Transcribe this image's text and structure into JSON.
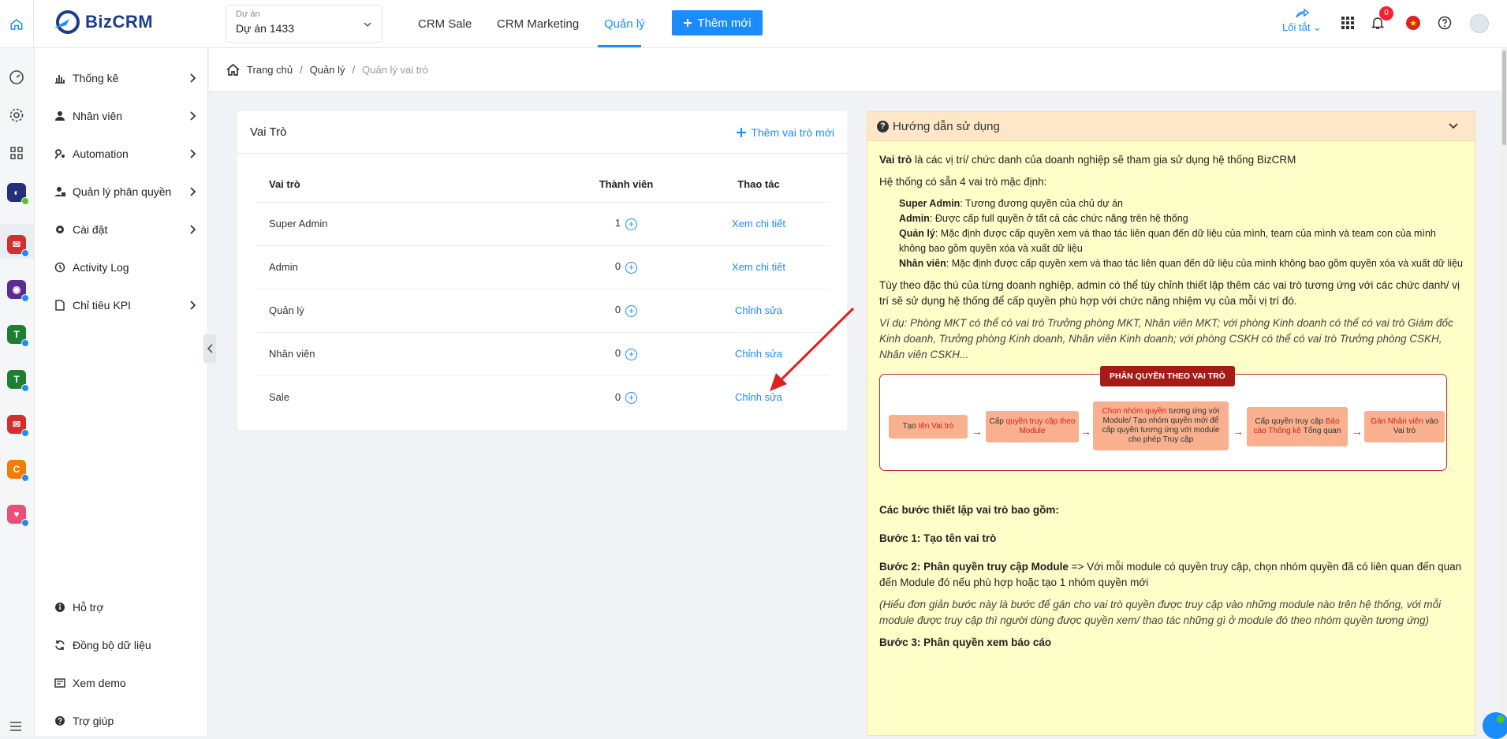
{
  "top": {
    "logo_text": "BizCRM",
    "project_label": "Dự án",
    "project_value": "Dự án 1433",
    "nav": [
      "CRM Sale",
      "CRM Marketing",
      "Quản lý"
    ],
    "new_button": "Thêm mới",
    "shortcut_label": "Lối tắt",
    "notification_count": "0"
  },
  "sidebar": {
    "items": [
      {
        "label": "Thống kê",
        "icon": "bar-chart-icon"
      },
      {
        "label": "Nhân viên",
        "icon": "user-icon"
      },
      {
        "label": "Automation",
        "icon": "automation-icon"
      },
      {
        "label": "Quản lý phân quyền",
        "icon": "user-lock-icon"
      },
      {
        "label": "Cài đặt",
        "icon": "gear-icon"
      },
      {
        "label": "Activity Log",
        "icon": "history-icon"
      },
      {
        "label": "Chỉ tiêu KPI",
        "icon": "file-icon"
      }
    ],
    "bottom": [
      {
        "label": "Hỗ trợ",
        "icon": "info-icon"
      },
      {
        "label": "Đồng bộ dữ liệu",
        "icon": "sync-icon"
      },
      {
        "label": "Xem demo",
        "icon": "demo-icon"
      },
      {
        "label": "Trợ giúp",
        "icon": "help-icon"
      }
    ]
  },
  "breadcrumb": {
    "home": "Trang chủ",
    "level1": "Quản lý",
    "current": "Quản lý vai trò"
  },
  "roles": {
    "title": "Vai Trò",
    "add_label": "Thêm vai trò mới",
    "headers": [
      "Vai trò",
      "Thành viên",
      "Thao tác"
    ],
    "rows": [
      {
        "name": "Super Admin",
        "members": "1",
        "action": "Xem chi tiết"
      },
      {
        "name": "Admin",
        "members": "0",
        "action": "Xem chi tiết"
      },
      {
        "name": "Quản lý",
        "members": "0",
        "action": "Chỉnh sửa"
      },
      {
        "name": "Nhân viên",
        "members": "0",
        "action": "Chỉnh sửa"
      },
      {
        "name": "Sale",
        "members": "0",
        "action": "Chỉnh sửa"
      }
    ]
  },
  "guide": {
    "title": "Hướng dẫn sử dụng",
    "intro_bold": "Vai trò",
    "intro_rest": " là các vị trí/ chức danh của doanh nghiệp sẽ tham gia sử dụng hệ thống BizCRM",
    "default_roles": "Hệ thống có sẵn 4 vai trò mặc định:",
    "list": [
      {
        "b": "Super Admin",
        "t": ": Tương đương quyền của chủ dự án"
      },
      {
        "b": "Admin",
        "t": ": Được cấp full quyền ở tất cả các chức năng trên hệ thống"
      },
      {
        "b": "Quản lý",
        "t": ": Mặc định được cấp quyền xem và thao tác liên quan đến dữ liệu của mình, team của mình và team con của mình không bao gồm quyền xóa và xuất dữ liệu"
      },
      {
        "b": "Nhân viên",
        "t": ": Mặc định được cấp quyền xem và thao tác liên quan đến dữ liệu của mình không bao gồm quyền xóa và xuất dữ liệu"
      }
    ],
    "custom": "Tùy theo đặc thù của từng doanh nghiệp, admin có thể tùy chỉnh thiết lập thêm các vai trò tương ứng với các chức danh/ vị trí sẽ sử dụng hệ thống để cấp quyền phù hợp với chức năng nhiệm vụ của mỗi vị trí đó.",
    "example": "Ví dụ: Phòng MKT có thể có vai trò Trưởng phòng MKT, Nhân viên MKT; với phòng Kinh doanh có thể có vai trò Giám đốc Kinh doanh, Trưởng phòng Kinh doanh, Nhân viên Kinh doanh; với phòng CSKH có thể có vai trò Trưởng phòng CSKH, Nhân viên CSKH...",
    "flow_title": "PHÂN QUYỀN THEO VAI TRÒ",
    "flow": [
      {
        "a": "Tạo ",
        "r": "tên Vai trò",
        "c": ""
      },
      {
        "a": "Cấp ",
        "r": "quyền truy cập theo Module",
        "c": ""
      },
      {
        "a": "",
        "r": "Chọn nhóm quyền",
        "c": " tương ứng với Module/ Tạo nhóm quyền mới để cấp quyền tương ứng với module cho phép Truy cập"
      },
      {
        "a": "Cấp quyền truy cập ",
        "r": "Báo cáo Thống kê",
        "c": " Tổng quan"
      },
      {
        "a": "",
        "r": "Gán Nhân viên",
        "c": " vào Vai trò"
      }
    ],
    "steps_title": "Các bước thiết lập vai trò bao gồm:",
    "step1": "Bước 1: Tạo tên vai trò",
    "step2_bold": "Bước 2: Phân quyền truy cập Module",
    "step2_rest": " => Với mỗi module có quyền truy cập, chọn nhóm quyền đã có liên quan đến quan đến Module đó nếu phù hợp hoặc tạo 1 nhóm quyền mới",
    "step2_note": "(Hiểu đơn giản bước này là bước để gán cho vai trò quyền được truy cập vào những module nào trên hệ thống, với mỗi module được truy cập thì người dùng được quyền xem/ thao tác những gì ở module đó theo nhóm quyền tương ứng)",
    "step3": "Bước 3: Phân quyền xem báo cáo"
  }
}
